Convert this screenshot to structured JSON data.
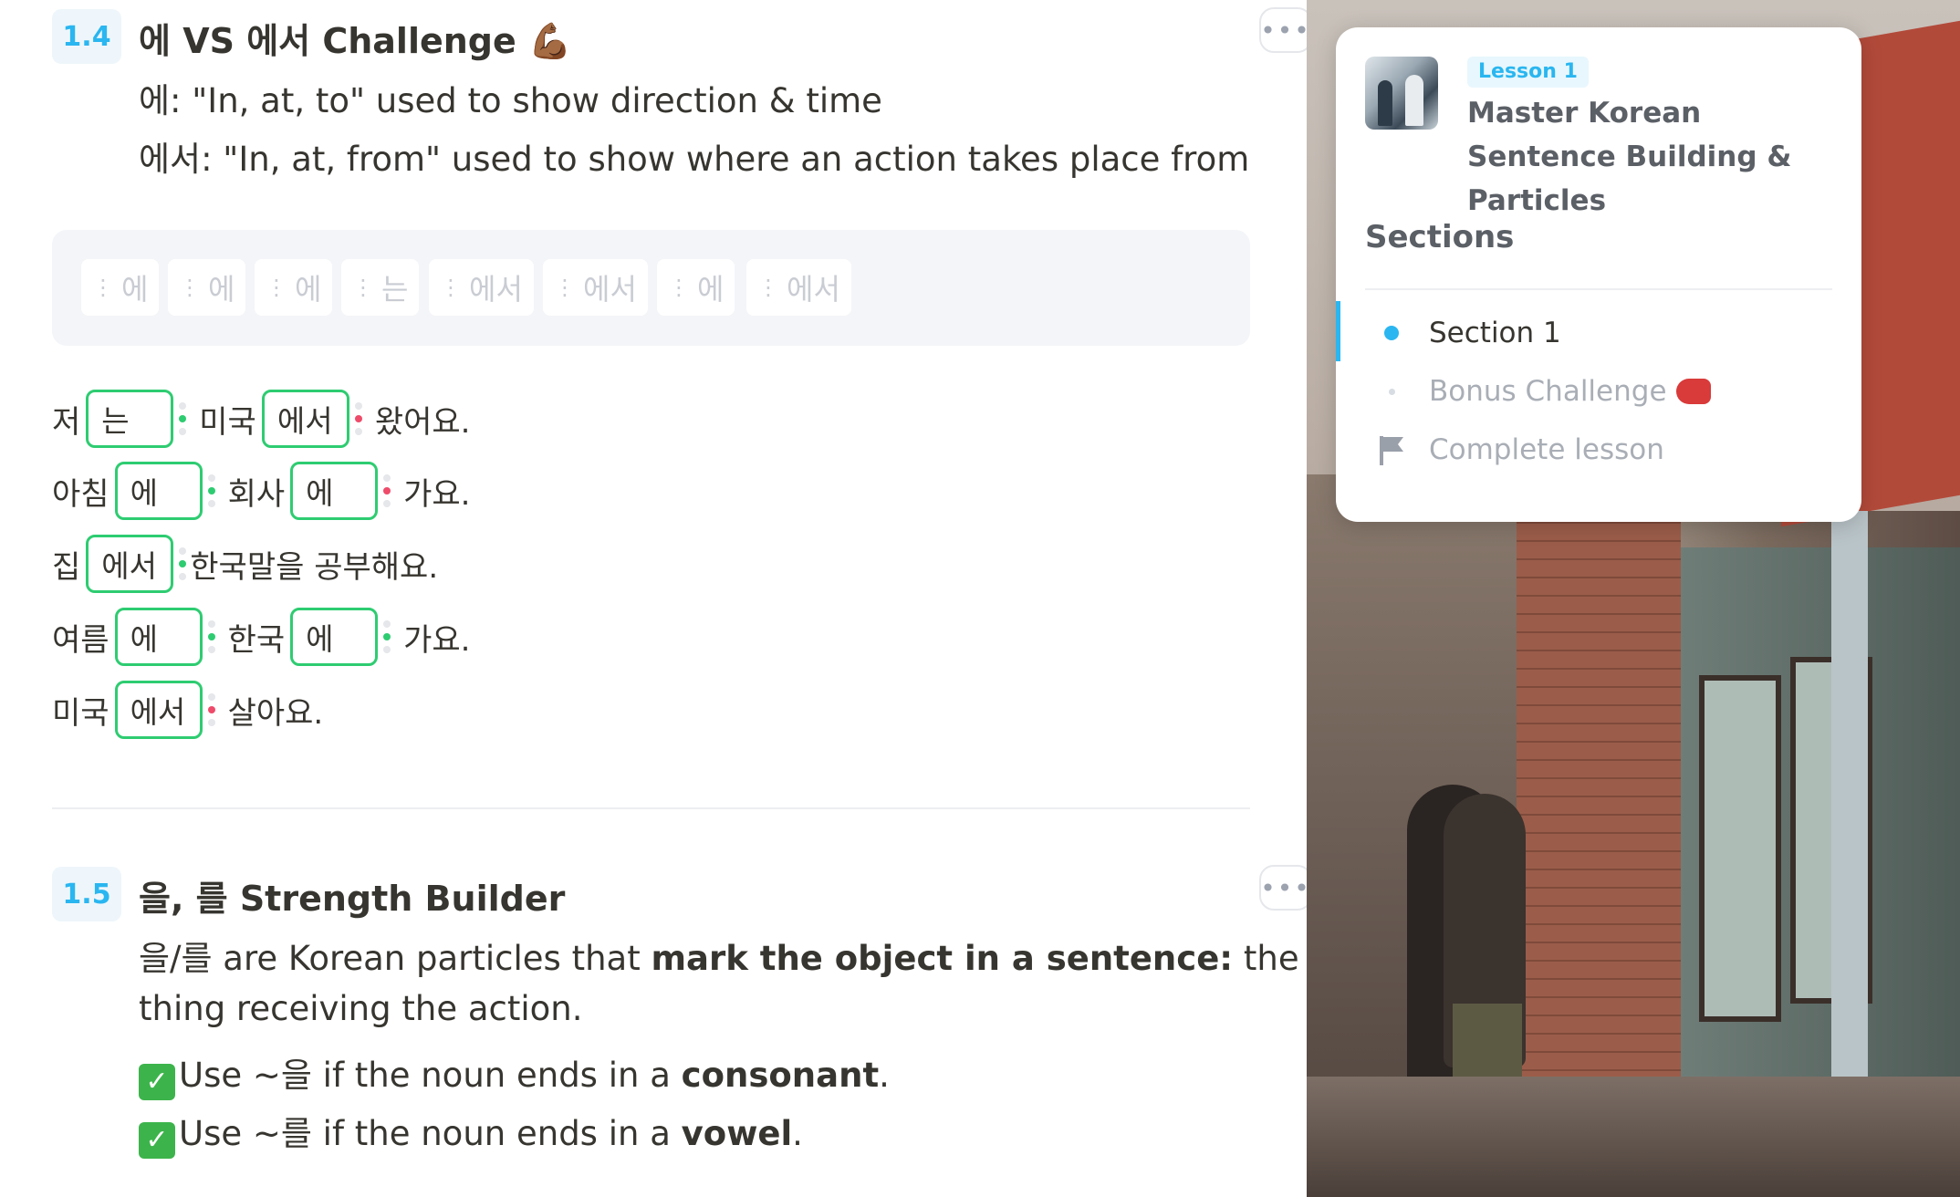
{
  "section_1_4": {
    "number": "1.4",
    "heading": "에 VS 에서 Challenge 💪🏾",
    "line1": "에: \"In, at, to\" used to show direction & time",
    "line2": "에서: \"In, at, from\" used to show where an action takes place from",
    "word_bank": [
      "에",
      "에",
      "에",
      "는",
      "에서",
      "에서",
      "에",
      "에서"
    ],
    "sentences": [
      {
        "parts": [
          {
            "type": "word",
            "text": "저"
          },
          {
            "type": "blank",
            "text": "는",
            "status": "correct"
          },
          {
            "type": "word",
            "text": "미국"
          },
          {
            "type": "blank",
            "text": "에서",
            "status": "incorrect"
          },
          {
            "type": "word",
            "text": "왔어요."
          }
        ]
      },
      {
        "parts": [
          {
            "type": "word",
            "text": "아침"
          },
          {
            "type": "blank",
            "text": "에",
            "status": "correct"
          },
          {
            "type": "word",
            "text": "회사"
          },
          {
            "type": "blank",
            "text": "에",
            "status": "incorrect"
          },
          {
            "type": "word",
            "text": "가요."
          }
        ]
      },
      {
        "parts": [
          {
            "type": "word",
            "text": "집"
          },
          {
            "type": "blank",
            "text": "에서",
            "status": "correct"
          },
          {
            "type": "word",
            "text": "한국말을 공부해요."
          }
        ]
      },
      {
        "parts": [
          {
            "type": "word",
            "text": "여름"
          },
          {
            "type": "blank",
            "text": "에",
            "status": "correct"
          },
          {
            "type": "word",
            "text": "한국"
          },
          {
            "type": "blank",
            "text": "에",
            "status": "correct"
          },
          {
            "type": "word",
            "text": "가요."
          }
        ]
      },
      {
        "parts": [
          {
            "type": "word",
            "text": "미국"
          },
          {
            "type": "blank",
            "text": "에서",
            "status": "incorrect"
          },
          {
            "type": "word",
            "text": "살아요."
          }
        ]
      }
    ]
  },
  "section_1_5": {
    "number": "1.5",
    "heading": "을, 를 Strength Builder",
    "line1_a": "을/를 are Korean particles that ",
    "line1_b": "mark the object in a sentence:",
    "line1_c": " the",
    "line2": "thing receiving the action.",
    "line3_a": "Use ~을 if the noun ends in a ",
    "line3_b": "consonant",
    "line3_c": ".",
    "line4_a": "Use ~를 if the noun ends in a ",
    "line4_b": "vowel",
    "line4_c": "."
  },
  "more_button_label": "•••",
  "card": {
    "lesson_badge": "Lesson 1",
    "lesson_title": "Master Korean Sentence Building & Particles",
    "sections_label": "Sections",
    "items": [
      {
        "label": "Section 1",
        "state": "active"
      },
      {
        "label": "Bonus Challenge",
        "state": "inactive"
      },
      {
        "label": "Complete lesson",
        "state": "inactive"
      }
    ]
  },
  "colors": {
    "accent": "#2ab6f0",
    "correct": "#2ecc71",
    "incorrect": "#ef4b6a"
  }
}
